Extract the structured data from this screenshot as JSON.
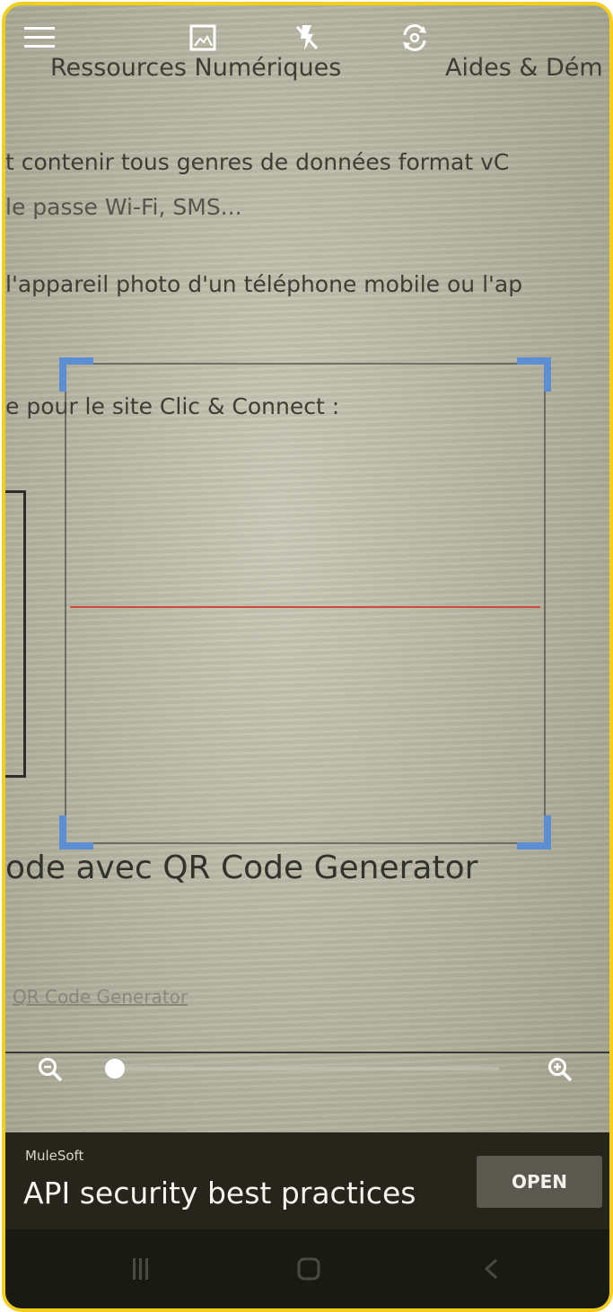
{
  "top_bar": {
    "icons": [
      "menu-icon",
      "gallery-icon",
      "flash-off-icon",
      "switch-camera-icon"
    ]
  },
  "camera_view": {
    "paper_lines": [
      "Ressources Numériques",
      "Aides & Dém",
      "t contenir tous genres de données  format vC",
      "le passe Wi-Fi, SMS...",
      "l'appareil photo d'un téléphone mobile ou l'ap",
      "e pour le site Clic & Connect :",
      "ode avec QR Code Generator",
      "QR Code Generator"
    ]
  },
  "scanner": {
    "frame_color": "#5b8fd1",
    "scan_line_color": "#d14a3a"
  },
  "zoom": {
    "out_icon": "zoom-out-icon",
    "in_icon": "zoom-in-icon",
    "level": 0.0
  },
  "ad": {
    "sponsor": "MuleSoft",
    "headline": "API security best practices",
    "button_label": "OPEN"
  },
  "navbar": {
    "icons": [
      "recent-apps-icon",
      "home-icon",
      "back-icon"
    ]
  },
  "colors": {
    "frame_border": "#f3cf1d",
    "ad_background": "#25251c"
  }
}
